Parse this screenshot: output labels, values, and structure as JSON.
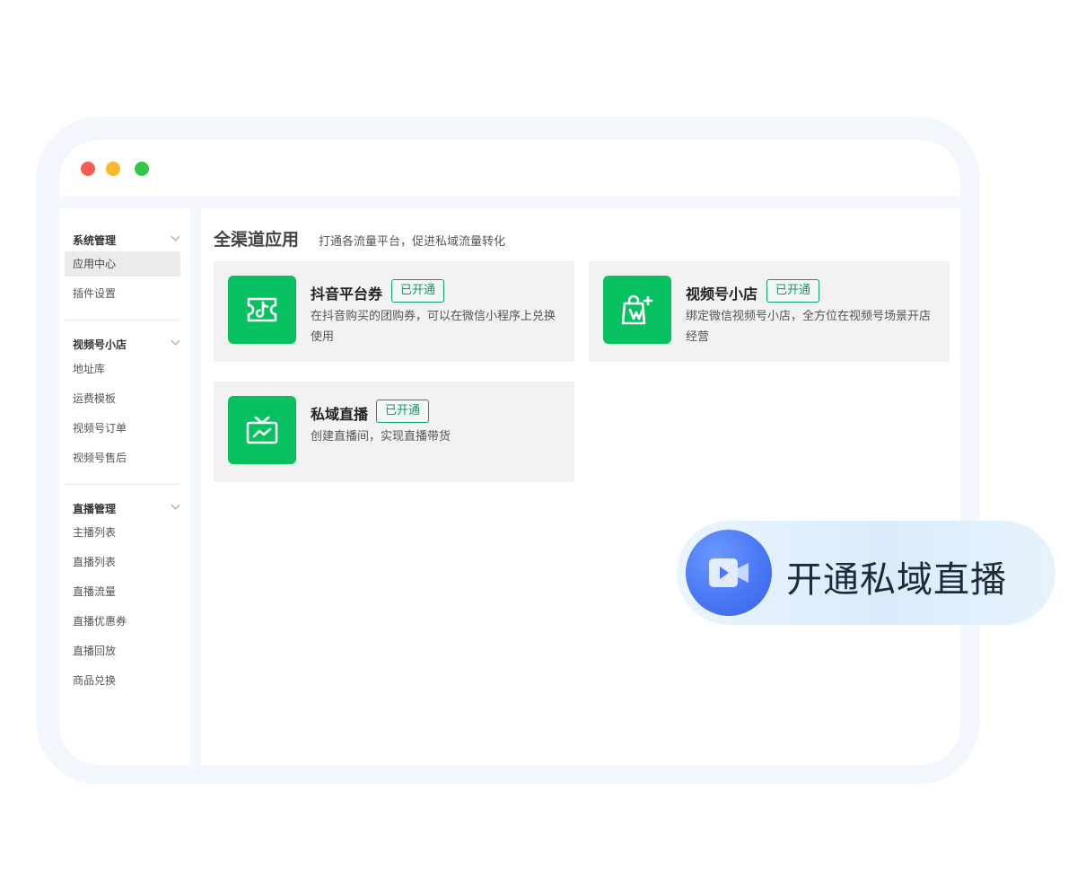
{
  "sidebar": {
    "groups": [
      {
        "title": "系统管理",
        "items": [
          "应用中心",
          "插件设置"
        ]
      },
      {
        "title": "视频号小店",
        "items": [
          "地址库",
          "运费模板",
          "视频号订单",
          "视频号售后"
        ]
      },
      {
        "title": "直播管理",
        "items": [
          "主播列表",
          "直播列表",
          "直播流量",
          "直播优惠券",
          "直播回放",
          "商品兑换"
        ]
      }
    ]
  },
  "main": {
    "title": "全渠道应用",
    "subtitle": "打通各流量平台，促进私域流量转化",
    "cards": [
      {
        "title": "抖音平台券",
        "badge": "已开通",
        "desc": "在抖音购买的团购券，可以在微信小程序上兑换使用",
        "icon": "ticket-icon"
      },
      {
        "title": "视频号小店",
        "badge": "已开通",
        "desc": "绑定微信视频号小店，全方位在视频号场景开店经营",
        "icon": "shopping-bag-icon"
      },
      {
        "title": "私域直播",
        "badge": "已开通",
        "desc": "创建直播间，实现直播带货",
        "icon": "tv-icon"
      }
    ]
  },
  "cta": {
    "label": "开通私域直播",
    "icon": "video-camera-icon"
  },
  "colors": {
    "accent_green": "#07c160",
    "badge_text": "#0d9b6c",
    "cta_blue": "#4a78f5"
  }
}
